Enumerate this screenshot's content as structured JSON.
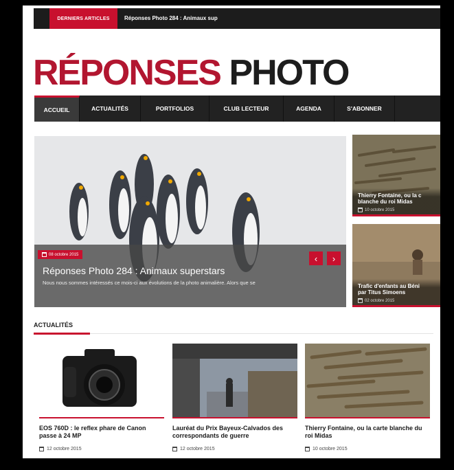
{
  "ticker": {
    "label": "DERNIERS ARTICLES",
    "text": "Réponses Photo 284 : Animaux sup"
  },
  "logo": {
    "part1": "RÉPONSES",
    "part2": "PHOTO"
  },
  "nav": {
    "items": [
      "ACCUEIL",
      "ACTUALITÉS",
      "PORTFOLIOS",
      "CLUB LECTEUR",
      "AGENDA",
      "S'ABONNER"
    ]
  },
  "hero": {
    "date": "08 octobre 2015",
    "title": "Réponses Photo 284 : Animaux superstars",
    "excerpt": "Nous nous sommes intéressés ce mois-ci aux évolutions de la photo animalière. Alors que se",
    "prev": "‹",
    "next": "›"
  },
  "side": [
    {
      "title_line1": "Thierry Fontaine, ou la c",
      "title_line2": "blanche du roi Midas",
      "date": "10 octobre 2015"
    },
    {
      "title_line1": "Trafic d'enfants au Béni",
      "title_line2": "par Titus Simoens",
      "date": "02 octobre 2015"
    }
  ],
  "section": {
    "title": "ACTUALITÉS"
  },
  "articles": [
    {
      "title": "EOS 760D : le reflex phare de Canon passe à 24 MP",
      "date": "12 octobre 2015"
    },
    {
      "title": "Lauréat du Prix Bayeux-Calvados des correspondants de guerre",
      "date": "12 octobre 2015"
    },
    {
      "title": "Thierry Fontaine, ou la carte blanche du roi Midas",
      "date": "10 octobre 2015"
    }
  ],
  "colors": {
    "accent": "#c8102e",
    "dark": "#222222",
    "logo_red": "#b21630"
  }
}
